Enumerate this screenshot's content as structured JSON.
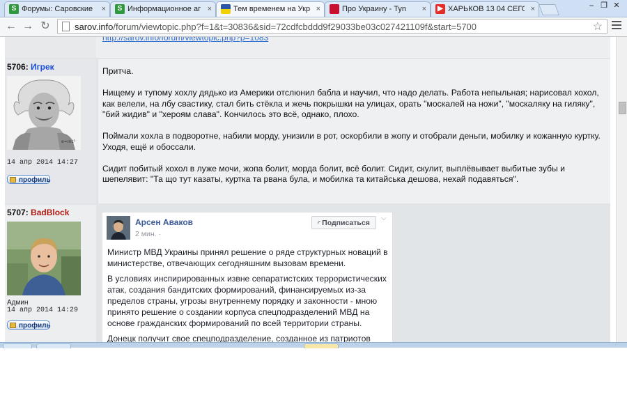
{
  "browser": {
    "tabs": [
      {
        "title": "Форумы: Саровские",
        "icon": "s-site-icon"
      },
      {
        "title": "Информационное аг",
        "icon": "s-site-icon"
      },
      {
        "title": "Тем временем на Укр",
        "icon": "flag-icon"
      },
      {
        "title": "Про Украину - Tyn",
        "icon": "square-icon"
      },
      {
        "title": "ХАРЬКОВ 13 04 СЕГО",
        "icon": "youtube-icon"
      }
    ],
    "url_host": "sarov.info",
    "url_path": "/forum/viewtopic.php?f=1&t=30836&sid=72cdfcbddd9f29033be03c027421109f&start=5700"
  },
  "forum": {
    "prev_post_link": "http://sarov.info/forum/viewtopic.php?p=1083",
    "posts": [
      {
        "number": "5706:",
        "username": "Игрек",
        "date": "14 апр 2014 14:27",
        "profile_label": "профиль",
        "paragraphs": [
          "Притча.",
          "Нищему и тупому хохлу дядько из Америки отслюнил бабла и научил, что надо делать. Работа непыльная; нарисовал хохол, как велели, на лбу свастику, стал бить стёкла и жечь покрышки на улицах, орать \"москалей на ножи\", \"москаляку на гиляку\", \"бий жидив\" и \"хероям слава\". Кончилось это всё, однако, плохо.",
          "Поймали хохла в подворотне, набили морду, унизили в рот, оскорбили в жопу и отобрали деньги, мобилку и кожанную куртку. Уходя, ещё и обоссали.",
          "Сидит побитый хохол в луже мочи, жопа болит, морда болит, всё болит. Сидит, скулит, выплёвывает выбитые зубы и шепелявит: \"Та що тут казаты, куртка та рвана була, и мобилка та китайська дешова, нехай подавяться\"."
        ]
      },
      {
        "number": "5707:",
        "username": "BadBlock",
        "role": "Админ",
        "date": "14 апр 2014 14:29",
        "profile_label": "профиль",
        "fb_embed": {
          "name": "Арсен Аваков",
          "time": "2 мин. ·",
          "subscribe_label": "Подписаться",
          "paragraphs": [
            "Министр МВД Украины принял решение о ряде структурных новаций в министерстве, отвечающих сегодняшним вызовам времени.",
            "В условиях инспирированных извне сепаратистских террористических атак, создания бандитских формирований, финансируемых из-за пределов страны, угрозы внутреннему порядку и законности - мною принято решение о создании корпуса спецподразделений МВД на основе гражданских формирований по всей территории страны.",
            "Донецк получит свое спецподразделение, созданное из патриотов"
          ]
        }
      }
    ]
  }
}
